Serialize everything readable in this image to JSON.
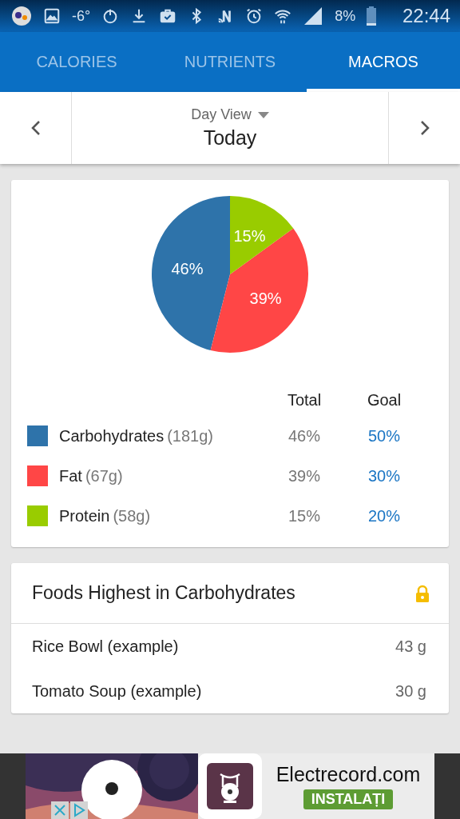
{
  "status_bar": {
    "temperature": "-6°",
    "battery": "8%",
    "time": "22:44"
  },
  "tabs": [
    {
      "label": "CALORIES",
      "selected": false
    },
    {
      "label": "NUTRIENTS",
      "selected": false
    },
    {
      "label": "MACROS",
      "selected": true
    }
  ],
  "day_selector": {
    "mode": "Day View",
    "date": "Today"
  },
  "macros_card": {
    "chart_data": {
      "type": "pie",
      "values": [
        46,
        39,
        15
      ],
      "value_labels": [
        "46%",
        "39%",
        "15%"
      ]
    },
    "columns": [
      "Total",
      "Goal"
    ],
    "rows": [
      {
        "name": "Carbohydrates",
        "amount": "(181g)",
        "color": "#2e73aa",
        "total": "46%",
        "goal": "50%"
      },
      {
        "name": "Fat",
        "amount": "(67g)",
        "color": "#ff4646",
        "total": "39%",
        "goal": "30%"
      },
      {
        "name": "Protein",
        "amount": "(58g)",
        "color": "#99cc00",
        "total": "15%",
        "goal": "20%"
      }
    ]
  },
  "foods_card": {
    "title": "Foods Highest in Carbohydrates",
    "locked": true,
    "items": [
      {
        "name": "Rice Bowl (example)",
        "amount": "43 g"
      },
      {
        "name": "Tomato Soup (example)",
        "amount": "30 g"
      }
    ]
  },
  "ad": {
    "kind": "picture",
    "title": "Electrecord.com",
    "button": "INSTALAȚI"
  }
}
